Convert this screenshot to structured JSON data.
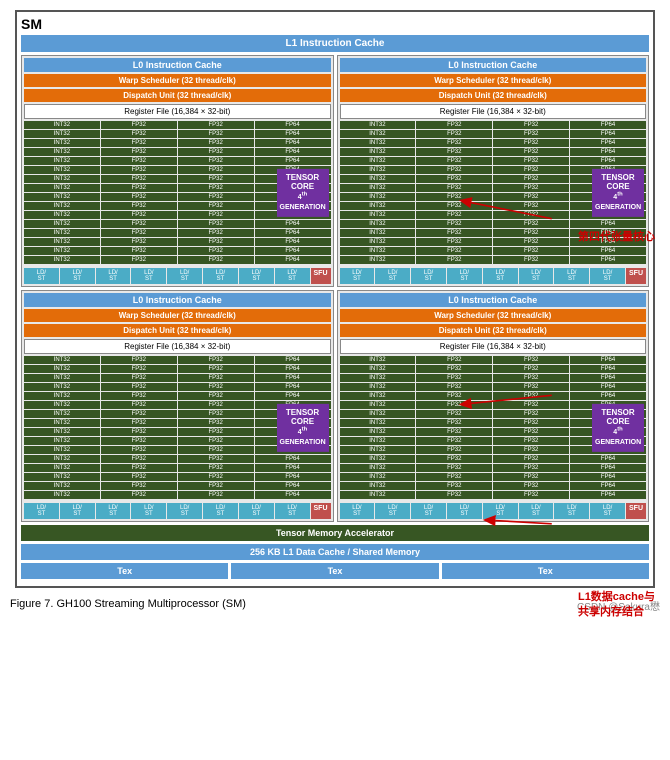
{
  "sm_label": "SM",
  "l1_instruction_cache": "L1 Instruction Cache",
  "l0_instruction_cache": "L0 Instruction Cache",
  "warp_scheduler": "Warp Scheduler (32 thread/clk)",
  "dispatch_unit": "Dispatch Unit (32 thread/clk)",
  "register_file": "Register File (16,384 × 32-bit)",
  "tensor_core_label_line1": "TENSOR CORE",
  "tensor_core_label_line2": "4th GENERATION",
  "tensor_memory_accelerator": "Tensor Memory Accelerator",
  "l1_data_cache": "256 KB L1 Data Cache / Shared Memory",
  "tex": "Tex",
  "sfu": "SFU",
  "figure_caption": "Figure 7.    GH100 Streaming Multiprocessor (SM)",
  "watermark": "CSDN @Sakura懋",
  "annotation1": "第四代张量核心",
  "annotation2": "L1数据cache与\n共享内存结合",
  "cells": {
    "int32": "INT32",
    "fp32": "FP32",
    "fp64": "FP64",
    "ld_st": "LD/\nST"
  }
}
